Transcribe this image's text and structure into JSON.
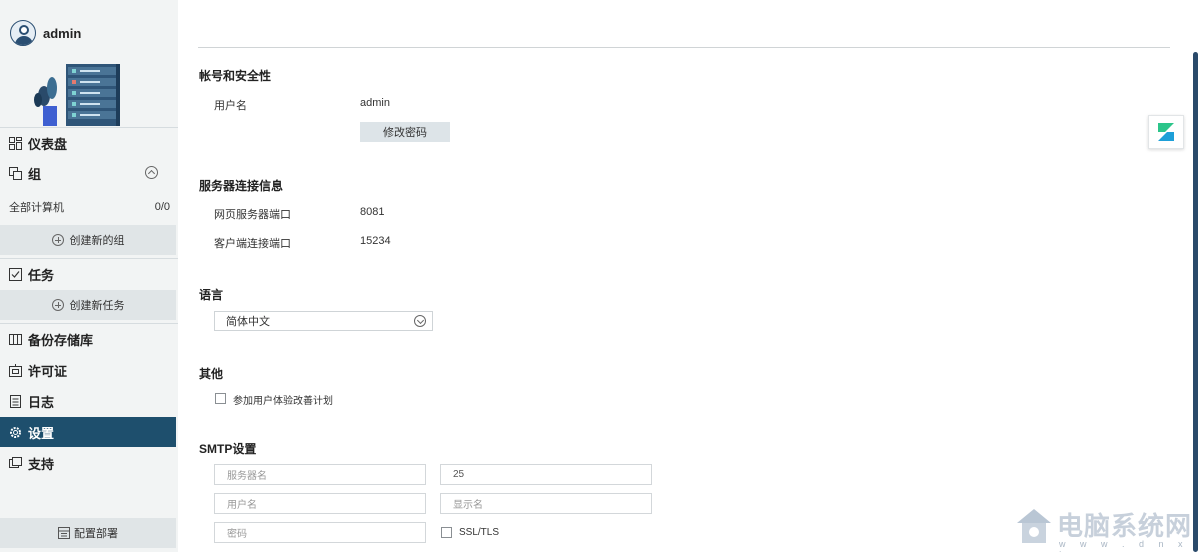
{
  "user": {
    "name": "admin"
  },
  "sidebar": {
    "dashboard": "仪表盘",
    "groups": "组",
    "all_computers": "全部计算机",
    "all_computers_count": "0/0",
    "create_group": "创建新的组",
    "tasks": "任务",
    "create_task": "创建新任务",
    "backup_storage": "备份存储库",
    "license": "许可证",
    "logs": "日志",
    "settings": "设置",
    "support": "支持",
    "deploy": "配置部署"
  },
  "account": {
    "title": "帐号和安全性",
    "username_label": "用户名",
    "username_value": "admin",
    "change_password": "修改密码"
  },
  "server": {
    "title": "服务器连接信息",
    "web_port_label": "网页服务器端口",
    "web_port_value": "8081",
    "client_port_label": "客户端连接端口",
    "client_port_value": "15234"
  },
  "language": {
    "title": "语言",
    "selected": "简体中文"
  },
  "other": {
    "title": "其他",
    "ux_program": "参加用户体验改善计划"
  },
  "smtp": {
    "title": "SMTP设置",
    "server_placeholder": "服务器名",
    "port_value": "25",
    "username_placeholder": "用户名",
    "display_name_placeholder": "显示名",
    "password_placeholder": "密码",
    "ssl_label": "SSL/TLS"
  },
  "watermark": {
    "text": "电脑系统网",
    "url": "w w w . d n x t w . c o m"
  },
  "colors": {
    "active_nav": "#1e4f6d",
    "sidebar_bg": "#f2f4f4",
    "scroll_thumb": "#2a4a6a"
  }
}
